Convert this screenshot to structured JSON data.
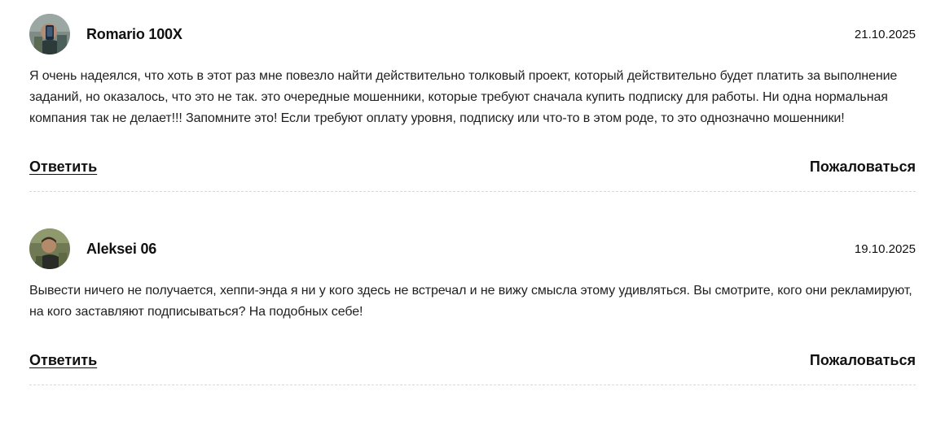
{
  "comments": [
    {
      "author": "Romario 100X",
      "date": "21.10.2025",
      "text": "Я очень надеялся, что хоть в этот раз мне повезло найти действительно толковый проект, который действительно будет платить за выполнение заданий, но оказалось, что это не так. это очередные мошенники, которые требуют сначала купить подписку для работы. Ни одна нормальная компания так не делает!!! Запомните это! Если требуют оплату уровня, подписку или что-то в этом роде, то это однозначно мошенники!",
      "reply_label": "Ответить",
      "complain_label": "Пожаловаться",
      "avatar_icon": "user-photo-icon"
    },
    {
      "author": "Aleksei 06",
      "date": "19.10.2025",
      "text": "Вывести ничего не получается, хеппи-энда я ни у кого здесь не встречал и не вижу смысла этому удивляться. Вы смотрите, кого они рекламируют, на кого заставляют подписываться? На подобных себе!",
      "reply_label": "Ответить",
      "complain_label": "Пожаловаться",
      "avatar_icon": "user-photo-icon"
    }
  ]
}
